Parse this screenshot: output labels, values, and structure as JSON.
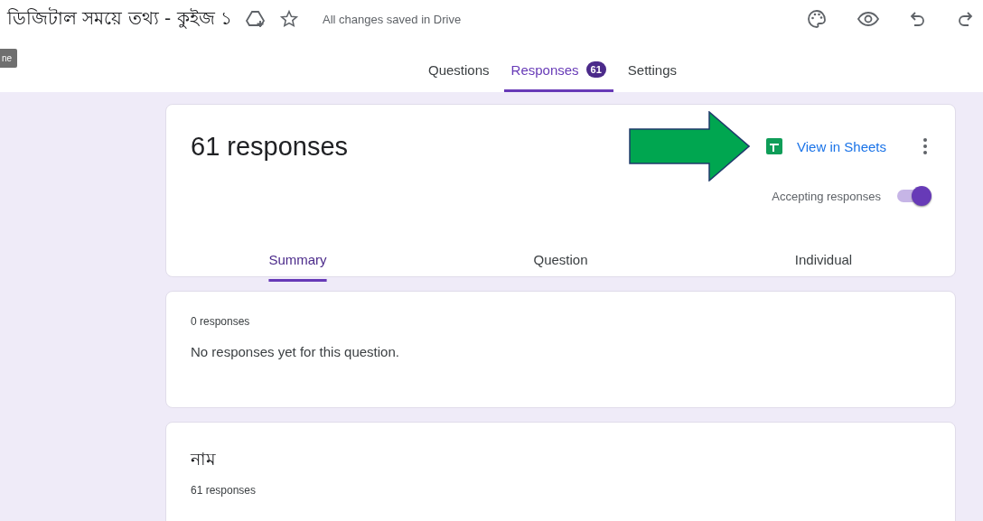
{
  "header": {
    "title": "ডিজিটাল সময়ে তথ্য - কুইজ ১",
    "save_status": "All changes saved in Drive",
    "side_label": "ne"
  },
  "tabs": [
    {
      "label": "Questions",
      "selected": false
    },
    {
      "label": "Responses",
      "selected": true,
      "badge": "61"
    },
    {
      "label": "Settings",
      "selected": false
    }
  ],
  "summary_card": {
    "title": "61 responses",
    "sheets_link": "View in Sheets",
    "accepting_label": "Accepting responses",
    "accepting_on": true,
    "view_tabs": [
      {
        "label": "Summary",
        "selected": true
      },
      {
        "label": "Question",
        "selected": false
      },
      {
        "label": "Individual",
        "selected": false
      }
    ]
  },
  "question_cards": [
    {
      "count": "0 responses",
      "message": "No responses yet for this question."
    },
    {
      "title": "নাম",
      "count": "61 responses"
    }
  ]
}
